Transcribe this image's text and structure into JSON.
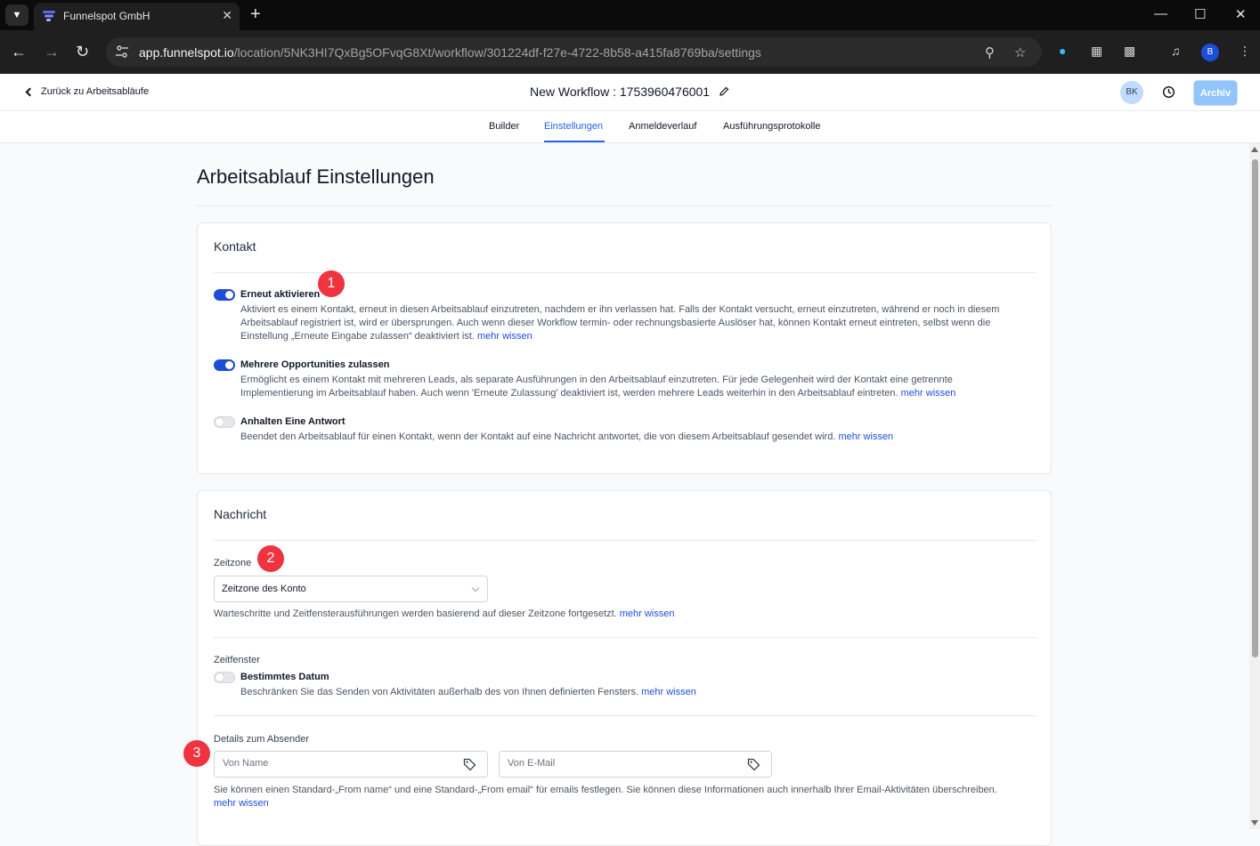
{
  "browser": {
    "tab_title": "Funnelspot GmbH",
    "url_host": "app.funnelspot.io",
    "url_path": "/location/5NK3HI7QxBg5OFvqG8Xt/workflow/301224df-f27e-4722-8b58-a415fa8769ba/settings",
    "profile_initial": "B",
    "icons": [
      "tab-list-icon",
      "funnelspot-favicon",
      "close-tab-icon",
      "new-tab-icon",
      "minimize-icon",
      "maximize-icon",
      "close-window-icon",
      "back-icon",
      "forward-icon",
      "reload-icon",
      "site-settings-icon",
      "zoom-icon",
      "bookmark-star-icon",
      "extension-icon",
      "devtools-icon",
      "puzzle-icon",
      "media-icon",
      "menu-icon"
    ]
  },
  "header": {
    "back_label": "Zurück zu Arbeitsabläufe",
    "workflow_title": "New Workflow : 1753960476001",
    "avatar_initials": "BK",
    "archive_label": "Archiv"
  },
  "tabs": [
    {
      "label": "Builder",
      "active": false
    },
    {
      "label": "Einstellungen",
      "active": true
    },
    {
      "label": "Anmeldeverlauf",
      "active": false
    },
    {
      "label": "Ausführungsprotokolle",
      "active": false
    }
  ],
  "page_title": "Arbeitsablauf Einstellungen",
  "kontakt": {
    "heading": "Kontakt",
    "options": [
      {
        "title": "Erneut aktivieren",
        "enabled": true,
        "description": "Aktiviert es einem Kontakt, erneut in diesen Arbeitsablauf einzutreten, nachdem er ihn verlassen hat. Falls der Kontakt versucht, erneut einzutreten, während er noch in diesem Arbeitsablauf registriert ist, wird er übersprungen. Auch wenn dieser Workflow termin- oder rechnungsbasierte Auslöser hat, können Kontakt erneut eintreten, selbst wenn die Einstellung „Erneute Eingabe zulassen“ deaktiviert ist.",
        "link": "mehr wissen"
      },
      {
        "title": "Mehrere Opportunities zulassen",
        "enabled": true,
        "description": "Ermöglicht es einem Kontakt mit mehreren Leads, als separate Ausführungen in den Arbeitsablauf einzutreten. Für jede Gelegenheit wird der Kontakt eine getrennte Implementierung im Arbeitsablauf haben. Auch wenn 'Erneute Zulassung' deaktiviert ist, werden mehrere Leads weiterhin in den Arbeitsablauf eintreten.",
        "link": "mehr wissen"
      },
      {
        "title": "Anhalten Eine Antwort",
        "enabled": false,
        "description": "Beendet den Arbeitsablauf für einen Kontakt, wenn der Kontakt auf eine Nachricht antwortet, die von diesem Arbeitsablauf gesendet wird.",
        "link": "mehr wissen"
      }
    ]
  },
  "nachricht": {
    "heading": "Nachricht",
    "zeitzone": {
      "label": "Zeitzone",
      "selected": "Zeitzone des Konto",
      "help": "Warteschritte und Zeitfensterausführungen werden basierend auf dieser Zeitzone fortgesetzt.",
      "link": "mehr wissen"
    },
    "zeitfenster": {
      "label": "Zeitfenster",
      "option_title": "Bestimmtes Datum",
      "enabled": false,
      "description": "Beschränken Sie das Senden von Aktivitäten außerhalb des von Ihnen definierten Fensters.",
      "link": "mehr wissen"
    },
    "absender": {
      "label": "Details zum Absender",
      "from_name_placeholder": "Von Name",
      "from_email_placeholder": "Von E-Mail",
      "help": "Sie können einen Standard-„From name“ und eine Standard-„From email“ für emails festlegen. Sie können diese Informationen auch innerhalb Ihrer Email-Aktivitäten überschreiben.",
      "link": "mehr wissen"
    }
  },
  "annotations": [
    "1",
    "2",
    "3"
  ],
  "colors": {
    "accent": "#2563eb",
    "toggle_on": "#1d4ed8",
    "badge": "#ef3340",
    "archive_button": "#93c5fd"
  }
}
